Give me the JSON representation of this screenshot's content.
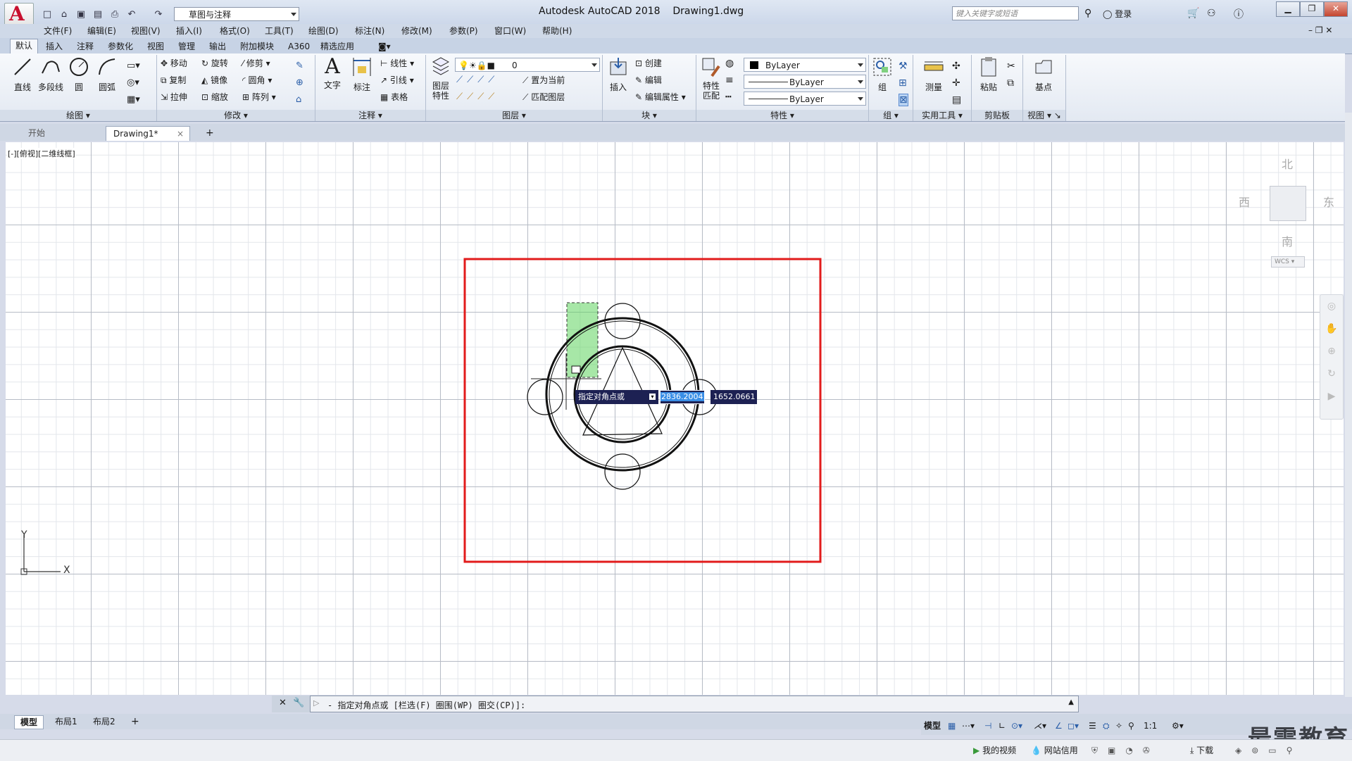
{
  "app": {
    "title": "Autodesk AutoCAD 2018",
    "filename": "Drawing1.dwg",
    "logo_letter": "A",
    "workspace": "草图与注释",
    "search_placeholder": "键入关键字或短语",
    "login": "登录"
  },
  "menu": [
    "文件(F)",
    "编辑(E)",
    "视图(V)",
    "插入(I)",
    "格式(O)",
    "工具(T)",
    "绘图(D)",
    "标注(N)",
    "修改(M)",
    "参数(P)",
    "窗口(W)",
    "帮助(H)"
  ],
  "ribbon_tabs": [
    "默认",
    "插入",
    "注释",
    "参数化",
    "视图",
    "管理",
    "输出",
    "附加模块",
    "A360",
    "精选应用"
  ],
  "ribbon": {
    "draw": {
      "title": "绘图",
      "line": "直线",
      "polyline": "多段线",
      "circle": "圆",
      "arc": "圆弧"
    },
    "modify": {
      "title": "修改",
      "move": "移动",
      "rotate": "旋转",
      "trim": "修剪",
      "copy": "复制",
      "mirror": "镜像",
      "fillet": "圆角",
      "stretch": "拉伸",
      "scale": "缩放",
      "array": "阵列"
    },
    "annotation": {
      "title": "注释",
      "text": "文字",
      "dimension": "标注",
      "linear": "线性",
      "leader": "引线",
      "table": "表格"
    },
    "layers": {
      "title": "图层",
      "properties": "图层\n特性",
      "layer_name": "0",
      "make_current": "置为当前",
      "match_layer": "匹配图层"
    },
    "block": {
      "title": "块",
      "insert": "插入",
      "create": "创建",
      "edit": "编辑",
      "edit_attr": "编辑属性"
    },
    "properties": {
      "title": "特性",
      "match": "特性\n匹配",
      "color": "ByLayer",
      "linetype": "ByLayer",
      "lineweight": "ByLayer"
    },
    "groups": {
      "title": "组",
      "group": "组"
    },
    "utilities": {
      "title": "实用工具",
      "measure": "测量"
    },
    "clipboard": {
      "title": "剪贴板",
      "paste": "粘贴"
    },
    "view": {
      "title": "视图",
      "base": "基点"
    }
  },
  "file_tabs": {
    "start": "开始",
    "drawing": "Drawing1*"
  },
  "viewport_label": "[-][俯视][二维线框]",
  "navcube": {
    "north": "北",
    "south": "南",
    "east": "东",
    "west": "西",
    "wcs": "WCS"
  },
  "ucs": {
    "x": "X",
    "y": "Y"
  },
  "dynamic_input": {
    "prompt": "指定对角点或",
    "x_value": "2836.2004",
    "y_value": "1652.0661"
  },
  "command_line": "- 指定对角点或 [栏选(F) 圈围(WP) 圈交(CP)]:",
  "layout_tabs": [
    "模型",
    "布局1",
    "布局2"
  ],
  "status": {
    "model": "模型",
    "scale": "1:1"
  },
  "taskbar": {
    "video": "我的视频",
    "netcredit": "网站信用",
    "download": "下载"
  },
  "watermark": "最需教育",
  "colors": {
    "accent_red": "#e21b1b",
    "selection_green": "#5fd35f",
    "autocad_red": "#c8102e"
  }
}
